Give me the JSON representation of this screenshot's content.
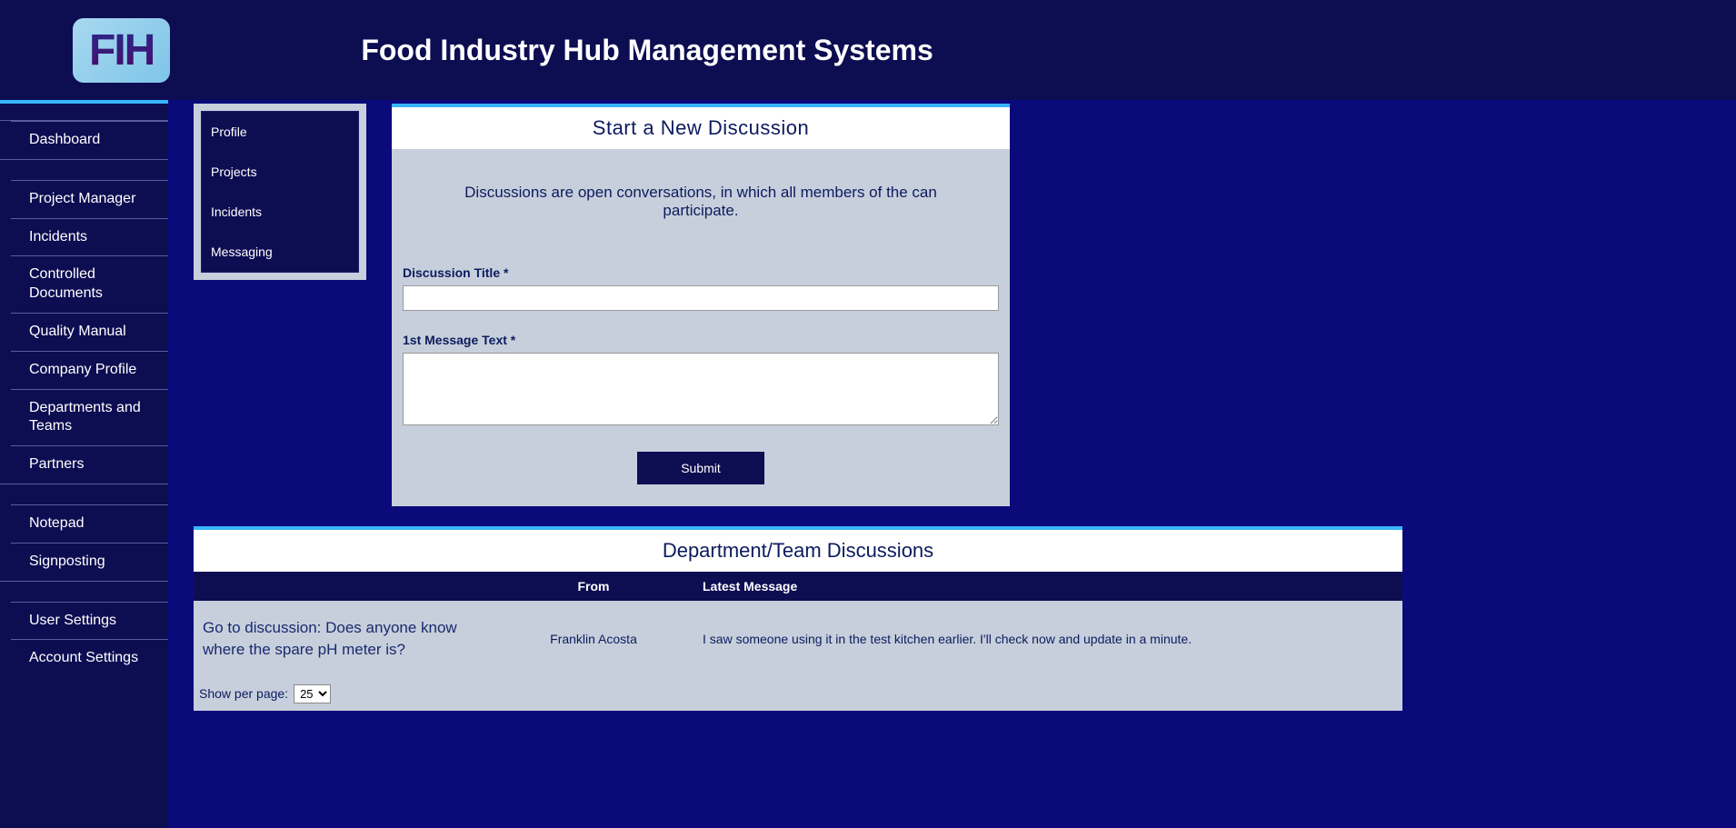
{
  "header": {
    "logo_text": "FIH",
    "title": "Food Industry Hub Management Systems"
  },
  "sidebar": {
    "groups": [
      [
        "Dashboard"
      ],
      [
        "Project Manager",
        "Incidents",
        "Controlled Documents",
        "Quality Manual",
        "Company Profile",
        "Departments and Teams",
        "Partners"
      ],
      [
        "Notepad",
        "Signposting"
      ],
      [
        "User Settings",
        "Account Settings"
      ]
    ]
  },
  "subnav": {
    "items": [
      "Profile",
      "Projects",
      "Incidents",
      "Messaging"
    ]
  },
  "discussion_form": {
    "title": "Start a New  Discussion",
    "description": "Discussions are open conversations, in which all members of the  can participate.",
    "title_label": "Discussion Title *",
    "message_label": "1st Message Text *",
    "submit_label": "Submit"
  },
  "discussions_panel": {
    "title": "Department/Team Discussions",
    "columns": {
      "from": "From",
      "latest": "Latest Message"
    },
    "rows": [
      {
        "subject": "Go to discussion: Does anyone know where the spare pH meter is?",
        "from": "Franklin Acosta",
        "latest": "I saw someone using it in the test kitchen earlier. I'll check now and update in a minute."
      }
    ],
    "pager": {
      "label": "Show per page:",
      "value": "25"
    }
  }
}
